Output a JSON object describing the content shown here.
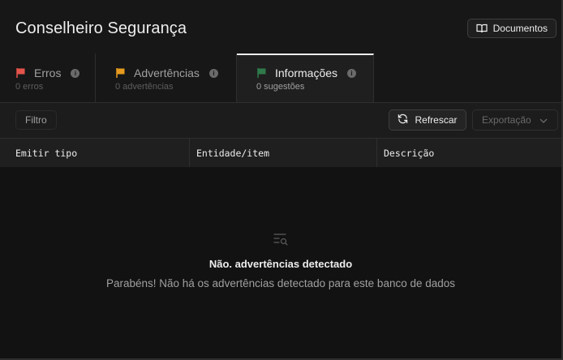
{
  "header": {
    "title": "Conselheiro Segurança",
    "docs_label": "Documentos"
  },
  "tabs": [
    {
      "label": "Erros",
      "count_text": "0 erros",
      "flag_color": "#e5544b",
      "icon": "flag-icon"
    },
    {
      "label": "Advertências",
      "count_text": "0 advertências",
      "flag_color": "#e69a1e",
      "icon": "flag-icon"
    },
    {
      "label": "Informações",
      "count_text": "0 sugestões",
      "flag_color": "#2f7a4a",
      "icon": "flag-icon",
      "active": true
    }
  ],
  "toolbar": {
    "filter_label": "Filtro",
    "refresh_label": "Refrescar",
    "export_label": "Exportação"
  },
  "table": {
    "columns": [
      "Emitir tipo",
      "Entidade/item",
      "Descrição"
    ]
  },
  "empty_state": {
    "title": "Não. advertências detectado",
    "message": "Parabéns! Não há os advertências detectado para este banco de dados"
  }
}
